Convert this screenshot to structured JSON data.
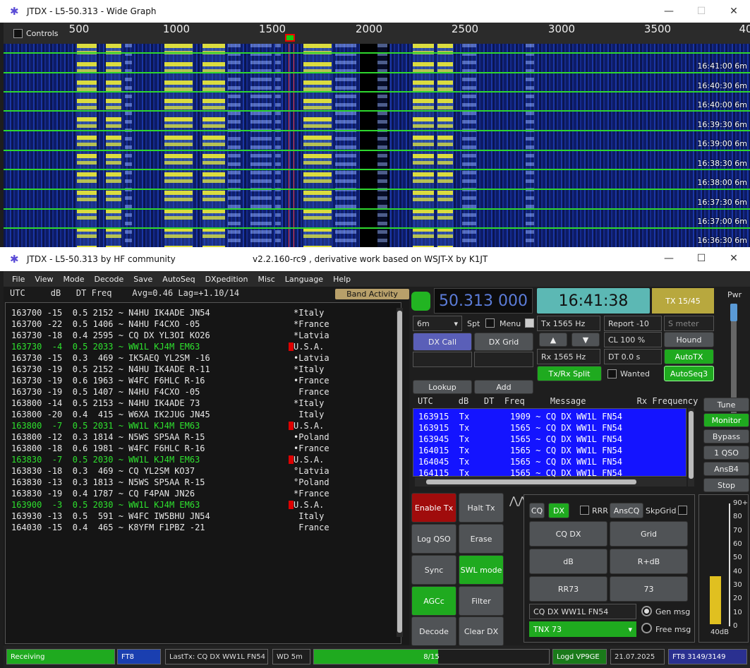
{
  "wide_graph": {
    "title": "JTDX - L5-50.313 - Wide Graph",
    "controls_label": "Controls",
    "scale_ticks": [
      "500",
      "1000",
      "1500",
      "2000",
      "2500",
      "3000",
      "3500",
      "40"
    ],
    "time_labels": [
      "16:41:00   6m",
      "16:40:30   6m",
      "16:40:00   6m",
      "16:39:30   6m",
      "16:39:00   6m",
      "16:38:30   6m",
      "16:38:00   6m",
      "16:37:30   6m",
      "16:37:00   6m",
      "16:36:30   6m"
    ]
  },
  "main": {
    "title": "JTDX - L5-50.313  by HF community",
    "subtitle": "v2.2.160-rc9 , derivative work based on WSJT-X by K1JT",
    "menu": [
      "File",
      "View",
      "Mode",
      "Decode",
      "Save",
      "AutoSeq",
      "DXpedition",
      "Misc",
      "Language",
      "Help"
    ]
  },
  "decode": {
    "header": "UTC     dB   DT Freq    Avg=0.46 Lag=+1.10/14",
    "band_activity": "Band Activity",
    "rows": [
      {
        "t": "163700 -15  0.5 2152 ~ N4HU IK4ADE JN54",
        "c": "*Italy",
        "g": false,
        "f": false
      },
      {
        "t": "163700 -22  0.5 1406 ~ N4HU F4CXO -05",
        "c": "*France",
        "g": false,
        "f": false
      },
      {
        "t": "163730 -18  0.4 2595 ~ CQ DX YL3OI KO26",
        "c": "*Latvia",
        "g": false,
        "f": false
      },
      {
        "t": "163730  -4  0.5 2033 ~ WW1L KJ4M EM63",
        "c": "U.S.A.",
        "g": true,
        "f": true
      },
      {
        "t": "163730 -15  0.3  469 ~ IK5AEQ YL2SM -16",
        "c": "•Latvia",
        "g": false,
        "f": false
      },
      {
        "t": "163730 -19  0.5 2152 ~ N4HU IK4ADE R-11",
        "c": "*Italy",
        "g": false,
        "f": false
      },
      {
        "t": "163730 -19  0.6 1963 ~ W4FC F6HLC R-16",
        "c": "•France",
        "g": false,
        "f": false
      },
      {
        "t": "163730 -19  0.5 1407 ~ N4HU F4CXO -05",
        "c": " France",
        "g": false,
        "f": false
      },
      {
        "t": "163800 -14  0.5 2153 ~ N4HU IK4ADE 73",
        "c": "*Italy",
        "g": false,
        "f": false
      },
      {
        "t": "163800 -20  0.4  415 ~ W6XA IK2JUG JN45",
        "c": " Italy",
        "g": false,
        "f": false
      },
      {
        "t": "163800  -7  0.5 2031 ~ WW1L KJ4M EM63",
        "c": "U.S.A.",
        "g": true,
        "f": true
      },
      {
        "t": "163800 -12  0.3 1814 ~ N5WS SP5AA R-15",
        "c": "•Poland",
        "g": false,
        "f": false
      },
      {
        "t": "163800 -18  0.6 1981 ~ W4FC F6HLC R-16",
        "c": "•France",
        "g": false,
        "f": false
      },
      {
        "t": "163830  -7  0.5 2030 ~ WW1L KJ4M EM63",
        "c": "U.S.A.",
        "g": true,
        "f": true
      },
      {
        "t": "163830 -18  0.3  469 ~ CQ YL2SM KO37",
        "c": "°Latvia",
        "g": false,
        "f": false
      },
      {
        "t": "163830 -13  0.3 1813 ~ N5WS SP5AA R-15",
        "c": "°Poland",
        "g": false,
        "f": false
      },
      {
        "t": "163830 -19  0.4 1787 ~ CQ F4PAN JN26",
        "c": "*France",
        "g": false,
        "f": false
      },
      {
        "t": "163900  -3  0.5 2030 ~ WW1L KJ4M EM63",
        "c": "U.S.A.",
        "g": true,
        "f": true
      },
      {
        "t": "163930 -13  0.5  591 ~ W4FC IW5BHU JN54",
        "c": " Italy",
        "g": false,
        "f": false
      },
      {
        "t": "164030 -15  0.4  465 ~ K8YFM F1PBZ -21",
        "c": " France",
        "g": false,
        "f": false
      }
    ]
  },
  "controls": {
    "freq": "50.313 000",
    "time": "16:41:38",
    "tx_period": "TX 15/45",
    "pwr": "Pwr",
    "band": "6m",
    "spt": "Spt",
    "menu": "Menu",
    "tx_hz": "Tx  1565  Hz",
    "rx_hz": "Rx  1565  Hz",
    "report": "Report  -10",
    "smeter": "S meter",
    "cl": "CL   100  %",
    "dt": "DT  0.0 s",
    "hound": "Hound",
    "autotx": "AutoTX",
    "autoseq3": "AutoSeq3",
    "wanted": "Wanted",
    "txrx_split": "Tx/Rx Split",
    "dx_call": "DX Call",
    "dx_grid": "DX Grid",
    "lookup": "Lookup",
    "add": "Add",
    "up": "▲",
    "down": "▼"
  },
  "tx_table": {
    "header": "UTC     dB   DT  Freq     Message          Rx Frequency",
    "rows": [
      "163915  Tx        1909 ~ CQ DX WW1L FN54",
      "163915  Tx        1565 ~ CQ DX WW1L FN54",
      "163945  Tx        1565 ~ CQ DX WW1L FN54",
      "164015  Tx        1565 ~ CQ DX WW1L FN54",
      "164045  Tx        1565 ~ CQ DX WW1L FN54",
      "164115  Tx        1565 ~ CQ DX WW1L FN54"
    ]
  },
  "side_buttons": [
    "Tune",
    "Monitor",
    "Bypass",
    "1 QSO",
    "AnsB4",
    "Stop"
  ],
  "action_buttons": {
    "enable_tx": "Enable Tx",
    "halt_tx": "Halt Tx",
    "log_qso": "Log QSO",
    "erase": "Erase",
    "sync": "Sync",
    "swl_mode": "SWL mode",
    "agcc": "AGCc",
    "filter": "Filter",
    "decode": "Decode",
    "clear_dx": "Clear DX"
  },
  "messages": {
    "cq": "CQ",
    "dx": "DX",
    "rrr": "RRR",
    "anscq": "AnsCQ",
    "skpgrid": "SkpGrid",
    "cq_dx": "CQ DX",
    "grid": "Grid",
    "db": "dB",
    "r_db": "R+dB",
    "rr73": "RR73",
    "s73": "73",
    "gen_text": "CQ DX WW1L FN54",
    "gen_msg": "Gen msg",
    "free_text": "TNX 73",
    "free_msg": "Free msg"
  },
  "meter": {
    "labels": [
      "90+",
      "80",
      "70",
      "60",
      "50",
      "40",
      "30",
      "20",
      "10",
      "0"
    ],
    "footer": "40dB",
    "level_db": 40
  },
  "status": {
    "state": "Receiving",
    "mode": "FT8",
    "last_tx": "LastTx: CQ DX WW1L FN54",
    "wd": "WD 5m",
    "progress_text": "8/15",
    "progress": 0.53,
    "logd": "Logd VP9GE",
    "date": "21.07.2025",
    "count": "FT8  3149/3149"
  }
}
